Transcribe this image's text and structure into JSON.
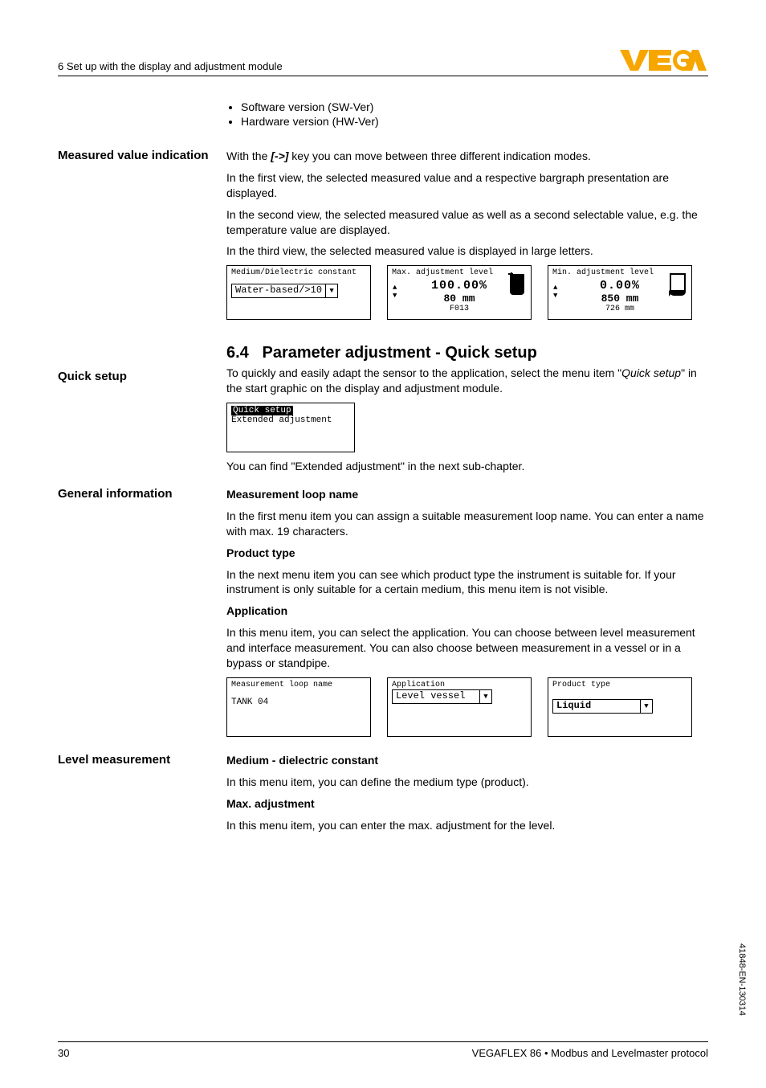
{
  "header": {
    "section_title": "6 Set up with the display and adjustment module",
    "logo_text": "VEGA"
  },
  "bullets": {
    "sw": "Software version (SW-Ver)",
    "hw": "Hardware version (HW-Ver)"
  },
  "measured_value": {
    "side_label": "Measured value indication",
    "p1a": "With the ",
    "p1key": "[->]",
    "p1b": " key you can move between three different indication modes.",
    "p2": "In the first view, the selected measured value and a respective bargraph presentation are displayed.",
    "p3": "In the second view, the selected measured value as well as a second selectable value, e.g. the temperature value are displayed.",
    "p4": "In the third view, the selected measured value is displayed in large letters."
  },
  "lcd1": {
    "title": "Medium/Dielectric constant",
    "value": "Water-based/>10"
  },
  "lcd2": {
    "title": "Max. adjustment level",
    "percent": "100.00%",
    "mm": "80 mm",
    "code": "F013"
  },
  "lcd3": {
    "title": "Min. adjustment level",
    "percent": "0.00%",
    "mm": "850 mm",
    "sub": "726 mm"
  },
  "section64": {
    "number": "6.4",
    "title": "Parameter adjustment - Quick setup"
  },
  "quick_setup": {
    "side_label": "Quick setup",
    "p1a": "To quickly and easily adapt the sensor to the application, select the menu item \"",
    "p1i": "Quick setup",
    "p1b": "\" in the start graphic on the display and adjustment module.",
    "lcd_line1": "Quick setup",
    "lcd_line2": "Extended adjustment",
    "p2": "You can find \"Extended adjustment\" in the next sub-chapter."
  },
  "general_info": {
    "side_label": "General information",
    "h1": "Measurement loop name",
    "p1": "In the first menu item you can assign a suitable measurement loop name. You can enter a name with max. 19 characters.",
    "h2": "Product type",
    "p2": "In the next menu item you can see which product type the instrument is suitable for. If your instrument is only suitable for a certain medium, this menu item is not visible.",
    "h3": "Application",
    "p3": "In this menu item, you can select the application. You can choose between level measurement and interface measurement. You can also choose between measurement in a vessel or in a bypass or standpipe."
  },
  "lcd4": {
    "title": "Measurement loop name",
    "value": "TANK 04"
  },
  "lcd5": {
    "title": "Application",
    "value": "Level vessel"
  },
  "lcd6": {
    "title": "Product type",
    "value": "Liquid"
  },
  "level_meas": {
    "side_label": "Level measurement",
    "h1": "Medium - dielectric constant",
    "p1": "In this menu item, you can define the medium type (product).",
    "h2": "Max. adjustment",
    "p2": "In this menu item, you can enter the max. adjustment for the level."
  },
  "footer": {
    "page": "30",
    "doc": "VEGAFLEX 86 • Modbus and Levelmaster protocol",
    "sidecode": "41848-EN-130314"
  }
}
